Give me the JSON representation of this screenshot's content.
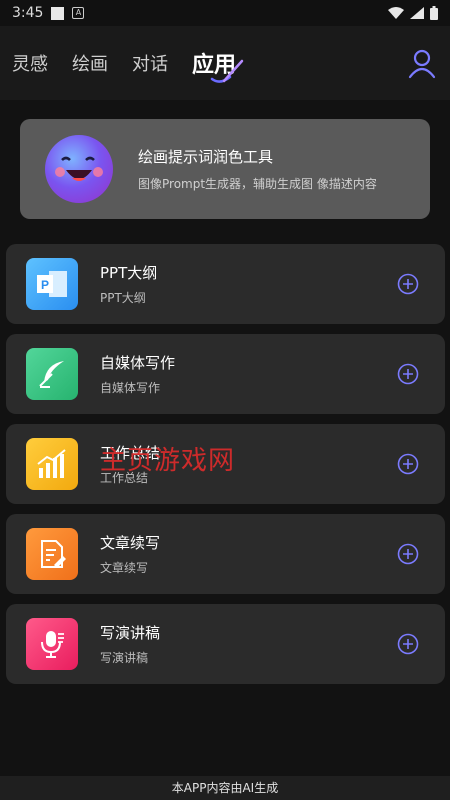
{
  "status_bar": {
    "time": "3:45"
  },
  "nav": {
    "tabs": [
      {
        "label": "灵感"
      },
      {
        "label": "绘画"
      },
      {
        "label": "对话"
      },
      {
        "label": "应用"
      }
    ],
    "profile_icon": "user-icon",
    "accent": "#6b6bff"
  },
  "banner": {
    "title": "绘画提示词润色工具",
    "subtitle": "图像Prompt生成器，辅助生成图 像描述内容"
  },
  "apps": [
    {
      "title": "PPT大纲",
      "subtitle": "PPT大纲",
      "icon": "presentation-icon",
      "color": "#3aa4f4"
    },
    {
      "title": "自媒体写作",
      "subtitle": "自媒体写作",
      "icon": "feather-icon",
      "color": "#35c283"
    },
    {
      "title": "工作总结",
      "subtitle": "工作总结",
      "icon": "bar-chart-icon",
      "color": "#f5b722"
    },
    {
      "title": "文章续写",
      "subtitle": "文章续写",
      "icon": "document-edit-icon",
      "color": "#f57c22"
    },
    {
      "title": "写演讲稿",
      "subtitle": "写演讲稿",
      "icon": "microphone-icon",
      "color": "#f2356f"
    }
  ],
  "watermark": "主页游戏网",
  "footer": "本APP内容由AI生成"
}
